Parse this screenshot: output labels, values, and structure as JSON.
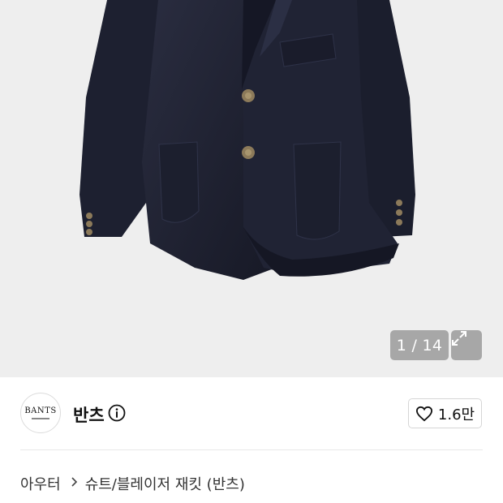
{
  "gallery": {
    "counter_text": "1 / 14",
    "expand_icon": "expand-icon",
    "background_color": "#eeeeee",
    "jacket_color": "#1f2233"
  },
  "brand": {
    "logo_text": "BANTS",
    "name": "반츠",
    "info_icon": "info-icon"
  },
  "like": {
    "icon": "heart-icon",
    "count": "1.6만"
  },
  "breadcrumb": {
    "items": [
      "아우터",
      "슈트/블레이저 재킷 (반츠)"
    ],
    "separator_icon": "chevron-right-icon"
  }
}
